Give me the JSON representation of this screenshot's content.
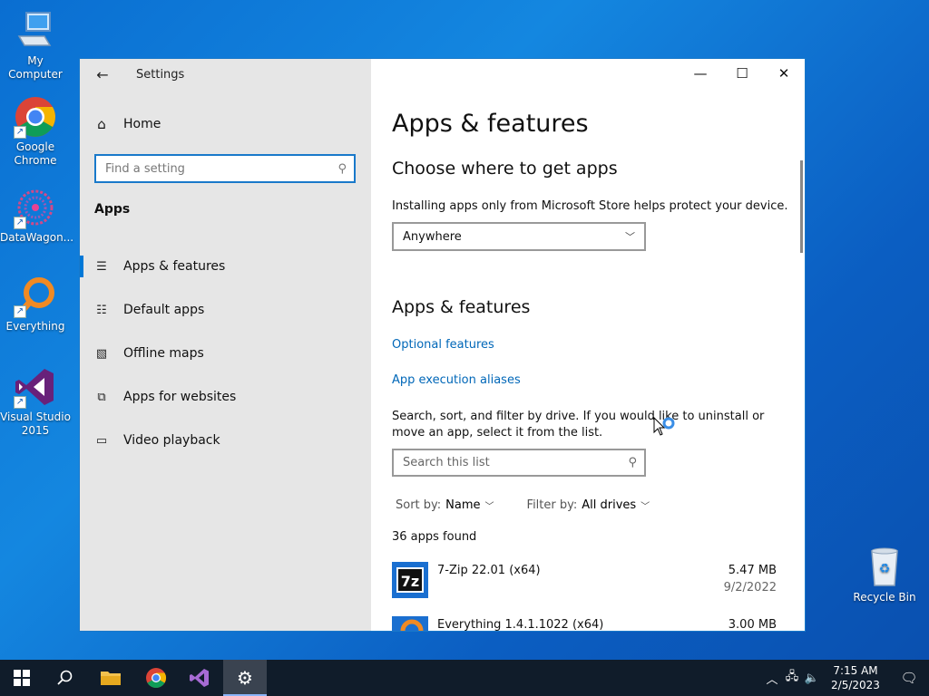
{
  "desktop": {
    "icons": [
      {
        "label": "My Computer"
      },
      {
        "label": "Google Chrome"
      },
      {
        "label": "DataWagon..."
      },
      {
        "label": "Everything"
      },
      {
        "label": "Visual Studio 2015"
      },
      {
        "label": "Recycle Bin"
      }
    ]
  },
  "window": {
    "title": "Settings",
    "sidebar": {
      "home_label": "Home",
      "search_placeholder": "Find a setting",
      "section_label": "Apps",
      "items": [
        {
          "label": "Apps & features",
          "icon": "list-icon"
        },
        {
          "label": "Default apps",
          "icon": "default-apps-icon"
        },
        {
          "label": "Offline maps",
          "icon": "map-icon"
        },
        {
          "label": "Apps for websites",
          "icon": "link-box-icon"
        },
        {
          "label": "Video playback",
          "icon": "video-icon"
        }
      ]
    },
    "content": {
      "page_title": "Apps & features",
      "choose_heading": "Choose where to get apps",
      "choose_text": "Installing apps only from Microsoft Store helps protect your device.",
      "source_dropdown_value": "Anywhere",
      "apps_heading": "Apps & features",
      "link_optional": "Optional features",
      "link_aliases": "App execution aliases",
      "search_help": "Search, sort, and filter by drive. If you would like to uninstall or move an app, select it from the list.",
      "search_placeholder": "Search this list",
      "sort_label": "Sort by:",
      "sort_value": "Name",
      "filter_label": "Filter by:",
      "filter_value": "All drives",
      "apps_found": "36 apps found",
      "apps": [
        {
          "name": "7-Zip 22.01 (x64)",
          "size": "5.47 MB",
          "date": "9/2/2022"
        },
        {
          "name": "Everything 1.4.1.1022 (x64)",
          "size": "3.00 MB",
          "date": ""
        }
      ]
    }
  },
  "taskbar": {
    "clock_time": "7:15 AM",
    "clock_date": "2/5/2023"
  },
  "colors": {
    "accent": "#0078d7",
    "link": "#0067b8",
    "taskbar": "#101c2a"
  }
}
